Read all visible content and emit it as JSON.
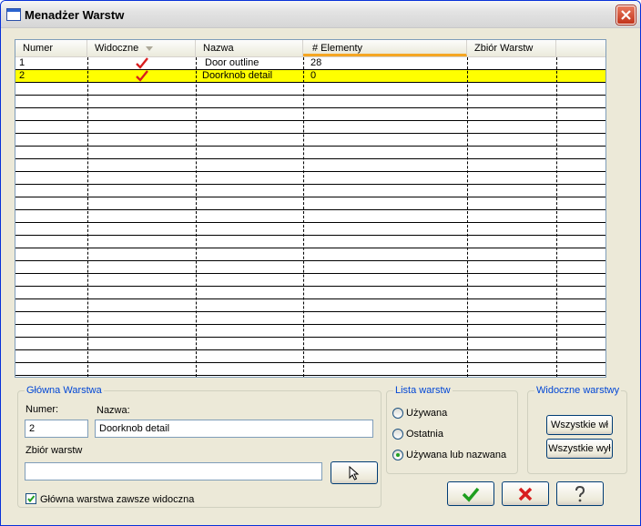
{
  "window": {
    "title": "Menadżer Warstw"
  },
  "grid": {
    "columns": [
      "Numer",
      "Widoczne",
      "Nazwa",
      "# Elementy",
      "Zbiór Warstw"
    ],
    "rows": [
      {
        "numer": "1",
        "visible": true,
        "nazwa": "Door outline",
        "elementy": "28",
        "zbior": ""
      },
      {
        "numer": "2",
        "visible": true,
        "nazwa": "Doorknob detail",
        "elementy": "0",
        "zbior": "",
        "selected": true
      }
    ],
    "selected_color": "#ffff00"
  },
  "main_layer": {
    "legend": "Główna Warstwa",
    "numer_label": "Numer:",
    "numer_value": "2",
    "nazwa_label": "Nazwa:",
    "nazwa_value": "Doorknob detail",
    "zbior_label": "Zbiór warstw",
    "zbior_value": "",
    "always_visible_label": "Główna warstwa zawsze widoczna",
    "always_visible_checked": true
  },
  "layer_list": {
    "legend": "Lista warstw",
    "options": [
      "Używana",
      "Ostatnia",
      "Używana lub nazwana"
    ],
    "selected": "Używana lub nazwana"
  },
  "visible_layers": {
    "legend": "Widoczne warstwy",
    "all_on_label": "Wszystkie wł",
    "all_off_label": "Wszystkie wył"
  },
  "icons": {
    "ok": "check-icon",
    "cancel": "cross-icon",
    "help": "question-icon",
    "picker": "cursor-arrow-icon"
  },
  "colors": {
    "accent_blue": "#0046d5",
    "check_red": "#d81e1e",
    "ok_green": "#1e9e1e"
  }
}
